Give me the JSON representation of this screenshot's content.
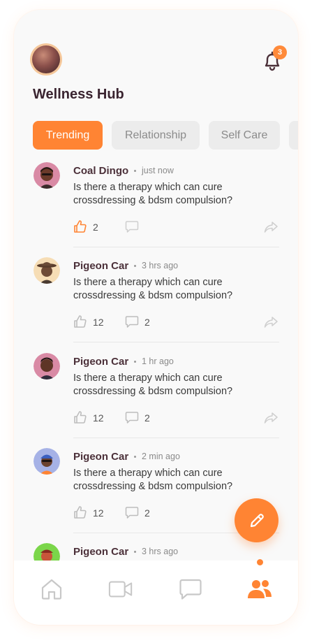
{
  "header": {
    "title": "Wellness Hub",
    "notification_count": "3"
  },
  "tabs": [
    {
      "label": "Trending",
      "active": true
    },
    {
      "label": "Relationship",
      "active": false
    },
    {
      "label": "Self Care",
      "active": false
    }
  ],
  "posts": [
    {
      "author": "Coal Dingo",
      "time": "just now",
      "text": "Is there a therapy which can cure crossdressing & bdsm compulsion?",
      "likes": "2",
      "comments": "",
      "liked": true
    },
    {
      "author": "Pigeon Car",
      "time": "3 hrs ago",
      "text": "Is there a therapy which can cure crossdressing & bdsm compulsion?",
      "likes": "12",
      "comments": "2",
      "liked": false
    },
    {
      "author": "Pigeon Car",
      "time": "1 hr ago",
      "text": "Is there a therapy which can cure crossdressing & bdsm compulsion?",
      "likes": "12",
      "comments": "2",
      "liked": false
    },
    {
      "author": "Pigeon Car",
      "time": "2 min ago",
      "text": "Is there a therapy which can cure crossdressing & bdsm compulsion?",
      "likes": "12",
      "comments": "2",
      "liked": false
    },
    {
      "author": "Pigeon Car",
      "time": "3 hrs ago",
      "text": "",
      "likes": "",
      "comments": "",
      "liked": false
    }
  ],
  "icons": {
    "notification": "bell-icon",
    "like": "thumbs-up-icon",
    "comment": "comment-bubble-icon",
    "share": "share-arrow-icon",
    "compose": "pencil-icon",
    "nav": [
      "home-icon",
      "video-icon",
      "chat-icon",
      "community-icon"
    ]
  },
  "colors": {
    "accent": "#ff8433",
    "title": "#3a2430",
    "tab_inactive_bg": "#ececec",
    "tab_inactive_text": "#8b8b8b"
  },
  "bottom_nav": {
    "active": "community"
  }
}
